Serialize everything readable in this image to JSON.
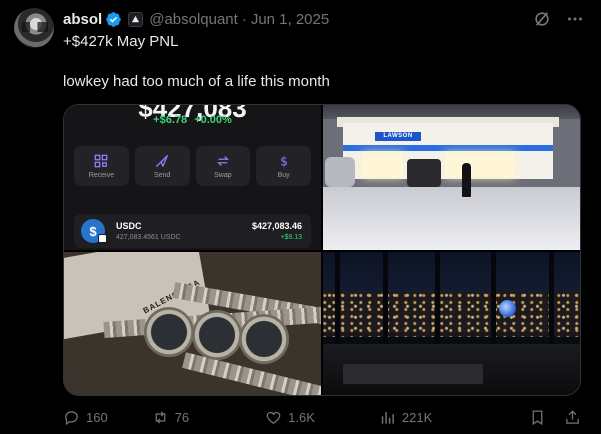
{
  "tweet": {
    "author_name": "absol",
    "handle": "@absolquant",
    "separator": "·",
    "date": "Jun 1, 2025",
    "line1": "+$427k May PNL",
    "line2": "lowkey had too much of a life this month"
  },
  "media": {
    "wallet": {
      "balance_partial": "$427,083",
      "change_amount": "+$6.78",
      "change_pct": "+0.00%",
      "actions": [
        {
          "label": "Receive",
          "icon": "qr-icon"
        },
        {
          "label": "Send",
          "icon": "send-icon"
        },
        {
          "label": "Swap",
          "icon": "swap-icon"
        },
        {
          "label": "Buy",
          "icon": "dollar-icon"
        }
      ],
      "asset": {
        "name": "USDC",
        "amount": "427,083.4561 USDC",
        "value": "$427,083.46",
        "gain": "+$9.13"
      }
    },
    "store_sign": "LAWSON",
    "paper_text": "BALENCIAGA"
  },
  "actions": {
    "replies": "160",
    "reposts": "76",
    "likes": "1.6K",
    "views": "221K"
  },
  "colors": {
    "verified": "#1d9bf0",
    "accent_green": "#3fd27a",
    "muted": "#71767b"
  }
}
